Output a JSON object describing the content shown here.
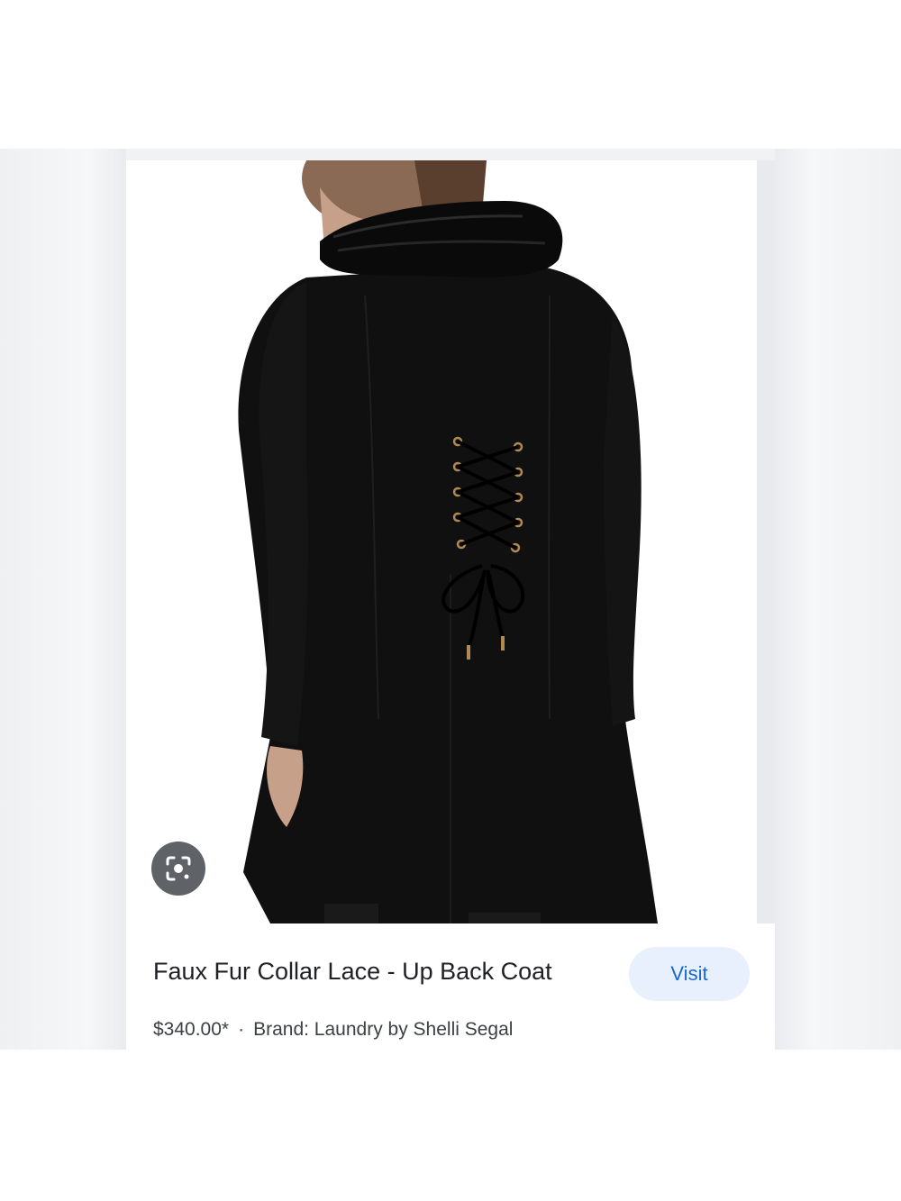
{
  "result": {
    "title": "Faux Fur Collar Lace - Up Back Coat",
    "visit_label": "Visit",
    "price": "$340.00*",
    "separator": "·",
    "brand": "Brand: Laundry by Shelli Segal"
  },
  "icons": {
    "lens": "google-lens-icon"
  },
  "colors": {
    "visit_bg": "#e8f0fe",
    "visit_text": "#1967d2",
    "lens_bg": "#5f6368",
    "background_band": "#f1f2f4"
  }
}
